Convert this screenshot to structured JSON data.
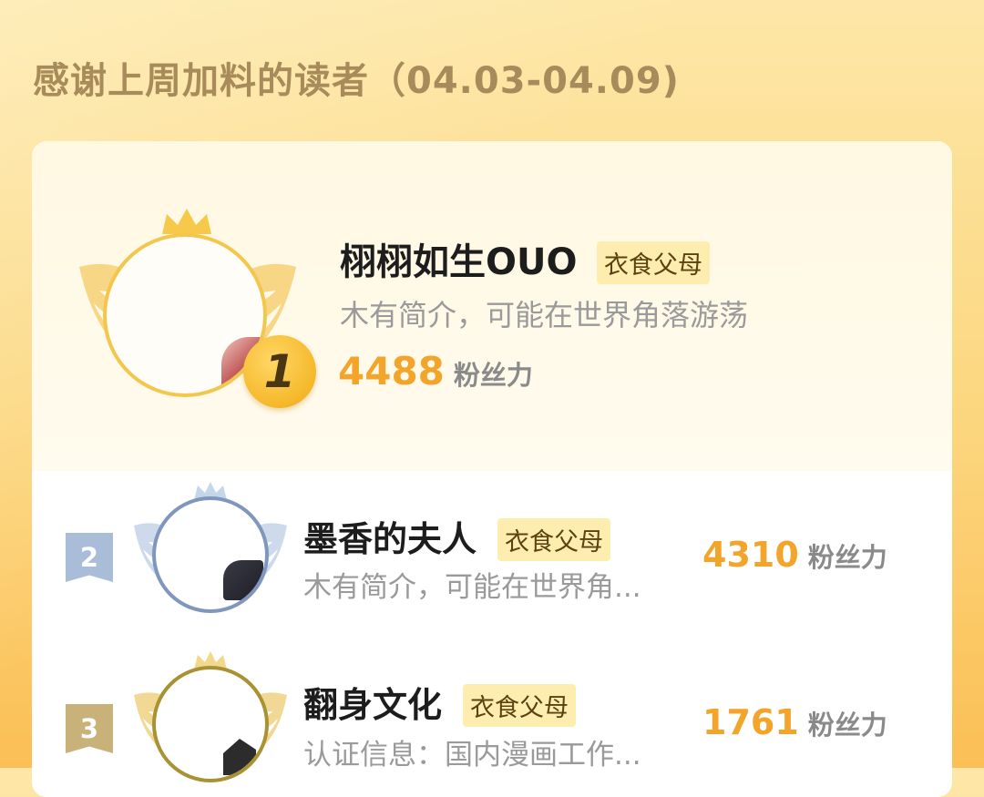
{
  "header": {
    "title": "感谢上周加料的读者（04.03-04.09)"
  },
  "leaderboard": [
    {
      "rank": "1",
      "name": "栩栩如生OUO",
      "badge": "衣食父母",
      "bio": "木有简介，可能在世界角落游荡",
      "score": "4488",
      "unit": "粉丝力"
    },
    {
      "rank": "2",
      "name": "墨香的夫人",
      "badge": "衣食父母",
      "bio": "木有简介，可能在世界角...",
      "score": "4310",
      "unit": "粉丝力"
    },
    {
      "rank": "3",
      "name": "翻身文化",
      "badge": "衣食父母",
      "bio": "认证信息：国内漫画工作...",
      "score": "1761",
      "unit": "粉丝力"
    }
  ],
  "colors": {
    "accent_score": "#f3a52b",
    "badge_bg": "#fdeeb0",
    "gold_ring": "#f3c74d",
    "silver_ring": "#7f96bd",
    "bronze_ring": "#a99233"
  }
}
